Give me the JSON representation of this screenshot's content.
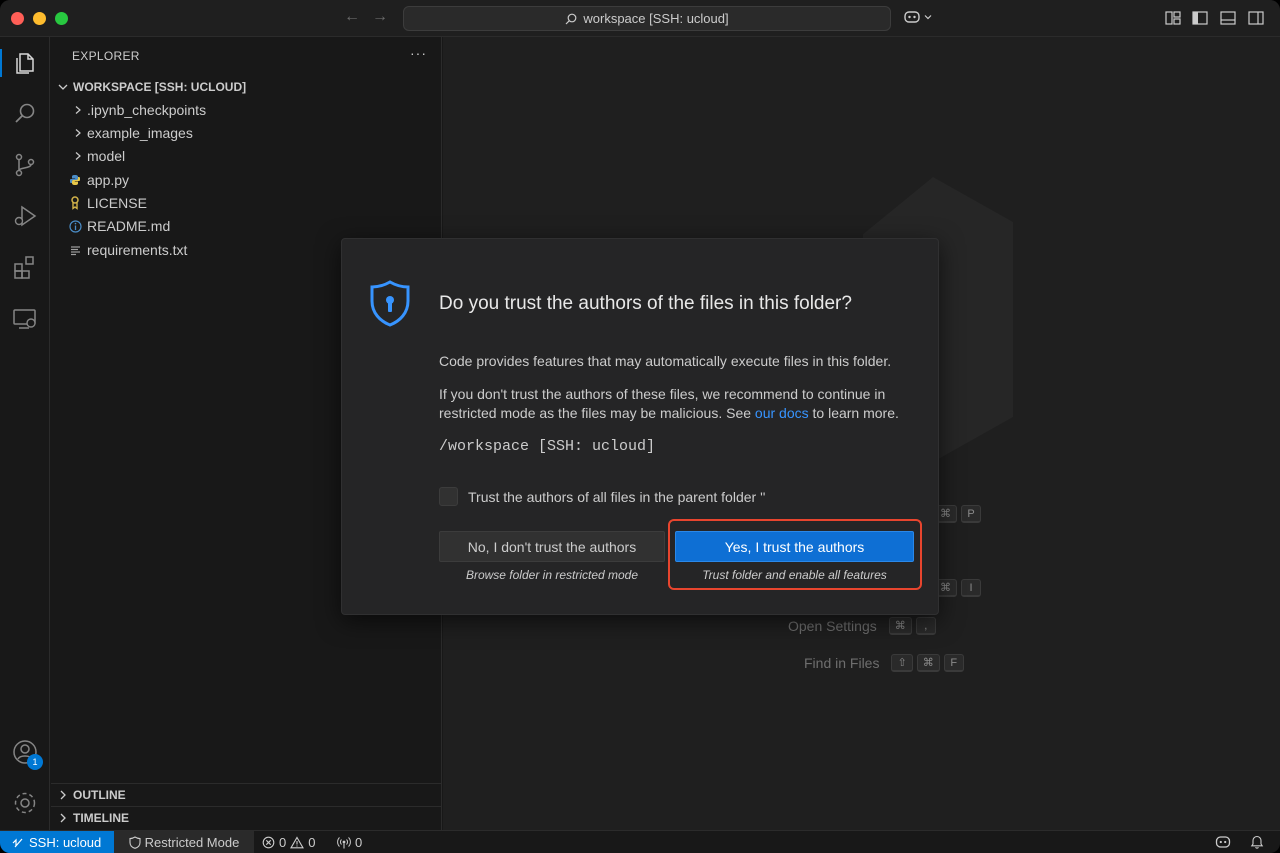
{
  "titlebar": {
    "command_center": "workspace [SSH: ucloud]"
  },
  "activity_bar": {
    "accounts_badge": "1"
  },
  "explorer": {
    "title": "EXPLORER",
    "more": "···",
    "workspace_header": "WORKSPACE [SSH: UCLOUD]",
    "items": [
      {
        "label": ".ipynb_checkpoints",
        "kind": "folder"
      },
      {
        "label": "example_images",
        "kind": "folder"
      },
      {
        "label": "model",
        "kind": "folder"
      },
      {
        "label": "app.py",
        "kind": "python"
      },
      {
        "label": "LICENSE",
        "kind": "license"
      },
      {
        "label": "README.md",
        "kind": "info"
      },
      {
        "label": "requirements.txt",
        "kind": "text"
      }
    ],
    "outline": "OUTLINE",
    "timeline": "TIMELINE"
  },
  "editor_shortcuts": [
    {
      "name": "Open Settings",
      "keys": [
        "⌘",
        ","
      ]
    },
    {
      "name": "Find in Files",
      "keys": [
        "⇧",
        "⌘",
        "F"
      ]
    }
  ],
  "partial_shortcut_keys": {
    "row1": [
      "⌘",
      "P"
    ],
    "row3": [
      "⌘",
      "I"
    ]
  },
  "dialog": {
    "title": "Do you trust the authors of the files in this folder?",
    "p1": "Code provides features that may automatically execute files in this folder.",
    "p2_before": "If you don't trust the authors of these files, we recommend to continue in restricted mode as the files may be malicious. See ",
    "p2_link": "our docs",
    "p2_after": " to learn more.",
    "path": "/workspace [SSH: ucloud]",
    "checkbox_label": "Trust the authors of all files in the parent folder ''",
    "checkbox_checked": false,
    "no_button": "No, I don't trust the authors",
    "no_sub": "Browse folder in restricted mode",
    "yes_button": "Yes, I trust the authors",
    "yes_sub": "Trust folder and enable all features"
  },
  "statusbar": {
    "remote": "SSH: ucloud",
    "restricted": "Restricted Mode",
    "errors": "0",
    "warnings": "0",
    "ports": "0"
  },
  "colors": {
    "accent": "#0078d4",
    "primary_button": "#0e6fd4",
    "link": "#3794ff",
    "highlight": "#e8452e"
  }
}
